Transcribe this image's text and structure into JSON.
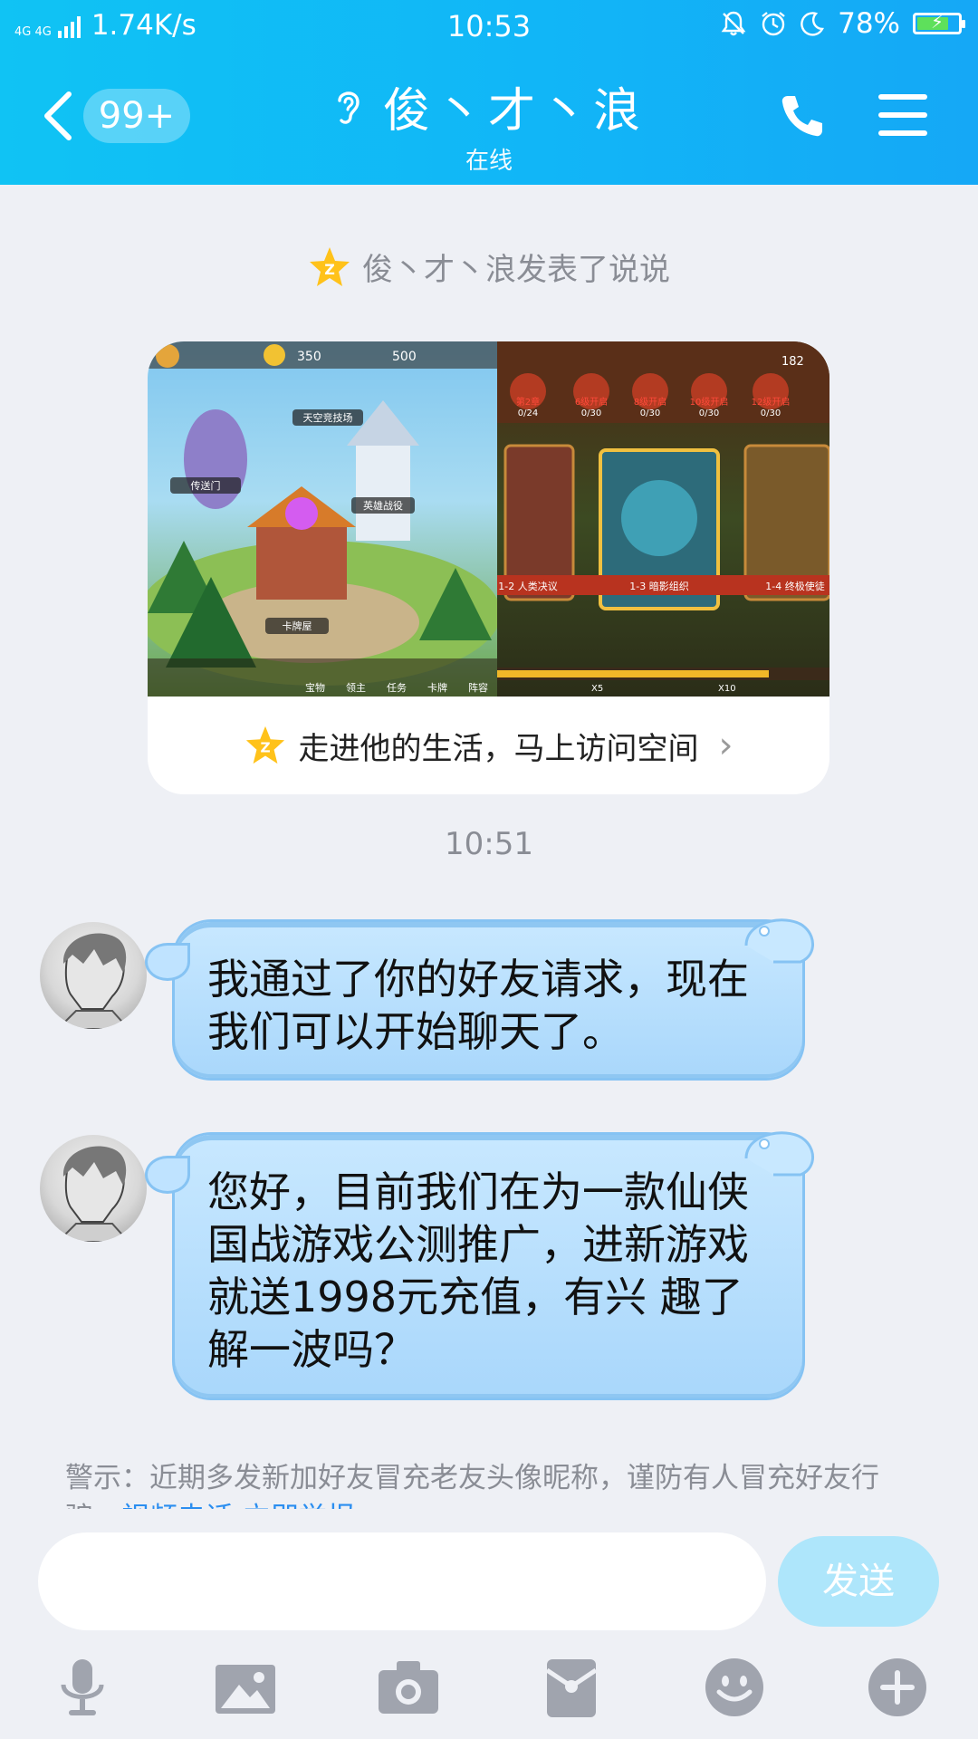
{
  "status": {
    "network": "4G 4G",
    "speed": "1.74K/s",
    "time": "10:53",
    "battery": "78%",
    "battery_level": 0.78
  },
  "header": {
    "unread_badge": "99+",
    "contact_name": "俊丶才丶浪",
    "presence": "在线"
  },
  "feed": {
    "system_line": "俊丶才丶浪发表了说说",
    "card_link": "走进他的生活，马上访问空间",
    "card_image": {
      "left": {
        "coins": "350",
        "gold": "500",
        "labels": [
          "天空竞技场",
          "传送门",
          "英雄战役",
          "卡牌屋",
          "宝物",
          "领主",
          "任务",
          "卡牌",
          "阵容"
        ]
      },
      "right": {
        "count": "182",
        "progress": [
          "0/24",
          "0/30",
          "0/30",
          "0/30",
          "0/30"
        ],
        "unlock": [
          "第2章",
          "6级开启",
          "8级开启",
          "10级开启",
          "12级开启"
        ],
        "stages": [
          "1-2 人类决议",
          "1-3 暗影组织",
          "1-4 终极使徒"
        ],
        "bottom": [
          "X5",
          "X10"
        ]
      }
    }
  },
  "chat": {
    "timestamp": "10:51",
    "messages": [
      {
        "text": "我通过了你的好友请求，现在我们可以开始聊天了。"
      },
      {
        "text": "您好，目前我们在为一款仙侠国战游戏公测推广，进新游戏就送1998元充值，有兴 趣了解一波吗？"
      }
    ]
  },
  "warning": {
    "text": "警示：近期多发新加好友冒充老友头像昵称，谨防有人冒充好友行骗，",
    "link": "视频电话 立即举报"
  },
  "composer": {
    "input_value": "",
    "send_label": "发送"
  },
  "toolbar": {
    "icons": [
      "microphone-icon",
      "image-icon",
      "camera-icon",
      "red-packet-icon",
      "emoji-icon",
      "plus-icon"
    ]
  },
  "colors": {
    "header": "#11b6f7",
    "bubble": "#a9d7fb",
    "send": "#aee6fb",
    "link": "#2b8ef0"
  }
}
